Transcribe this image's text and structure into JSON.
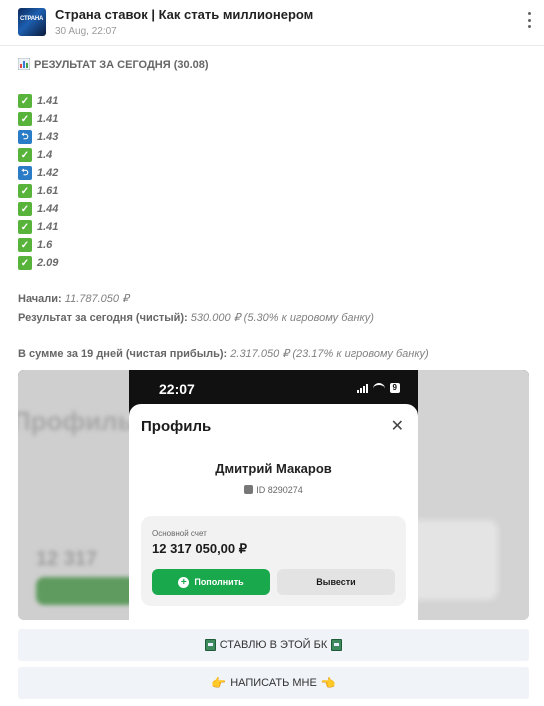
{
  "channel": {
    "avatar_text": "СТРАНА",
    "title": "Страна ставок | Как стать миллионером",
    "date": "30 Aug, 22:07",
    "menu_icon": "more-vertical-icon"
  },
  "post": {
    "heading": "РЕЗУЛЬТАТ ЗА СЕГОДНЯ (30.08)",
    "heading_icon": "bar-chart-icon",
    "results": [
      {
        "status": "check",
        "value": "1.41"
      },
      {
        "status": "check",
        "value": "1.41"
      },
      {
        "status": "return",
        "value": "1.43"
      },
      {
        "status": "check",
        "value": "1.4"
      },
      {
        "status": "return",
        "value": "1.42"
      },
      {
        "status": "check",
        "value": "1.61"
      },
      {
        "status": "check",
        "value": "1.44"
      },
      {
        "status": "check",
        "value": "1.41"
      },
      {
        "status": "check",
        "value": "1.6"
      },
      {
        "status": "check",
        "value": "2.09"
      }
    ],
    "start_label": "Начали:",
    "start_value": "11.787.050 ₽",
    "today_label": "Результат за сегодня (чистый):",
    "today_value": "530.000 ₽ (5.30% к игровому банку)",
    "total_label": "В сумме за 19 дней (чистая прибыль):",
    "total_value": "2.317.050 ₽ (23.17% к игровому банку)"
  },
  "screenshot": {
    "time": "22:07",
    "battery": "9",
    "bg_title": "Профиль",
    "bg_amount": "12 317",
    "title": "Профиль",
    "close": "✕",
    "user_name": "Дмитрий Макаров",
    "user_id": "ID 8290274",
    "account_label": "Основной счет",
    "account_amount": "12 317 050,00 ₽",
    "topup_label": "Пополнить",
    "withdraw_label": "Вывести"
  },
  "buttons": {
    "bet_label": "СТАВЛЮ В ЭТОЙ БК",
    "write_label": "НАПИСАТЬ МНЕ",
    "write_icon_left": "👉",
    "write_icon_right": "👈"
  },
  "colors": {
    "check": "#57b33a",
    "return": "#2a7cc7",
    "topup": "#19a84b",
    "button_bg": "#f0f3f8"
  }
}
